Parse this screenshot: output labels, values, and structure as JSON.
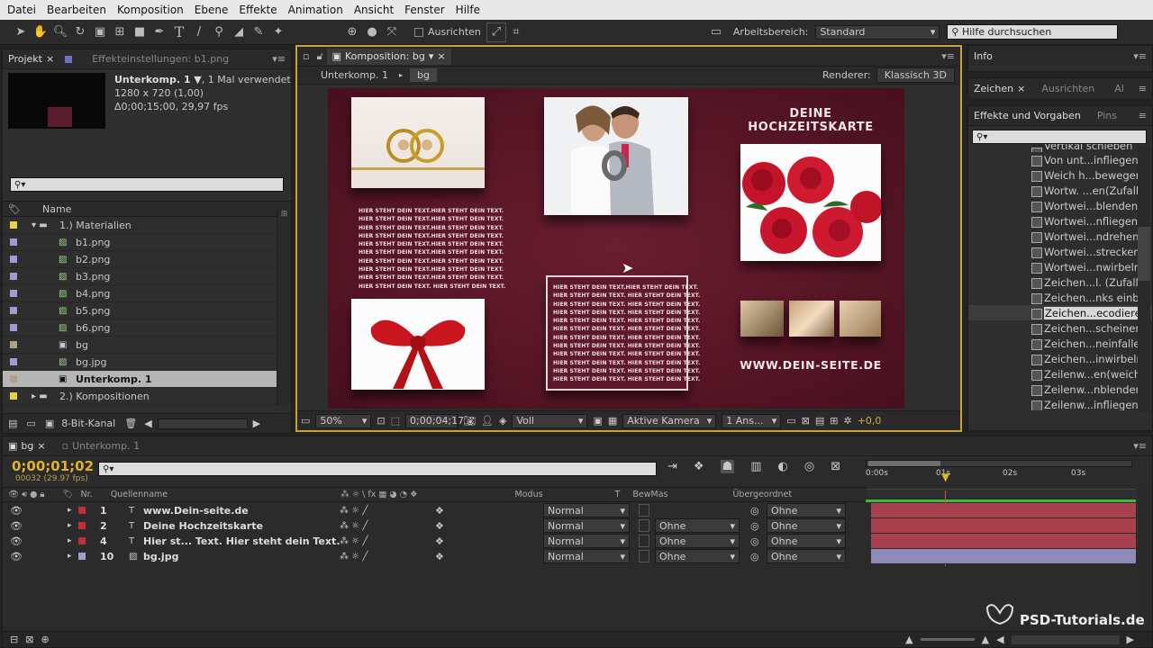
{
  "menu": [
    "Datei",
    "Bearbeiten",
    "Komposition",
    "Ebene",
    "Effekte",
    "Animation",
    "Ansicht",
    "Fenster",
    "Hilfe"
  ],
  "toolbar": {
    "align_label": "Ausrichten",
    "workspace_label": "Arbeitsbereich:",
    "workspace_value": "Standard",
    "help_placeholder": "Hilfe durchsuchen"
  },
  "project": {
    "tab_project": "Projekt",
    "tab_effects": "Effekteinstellungen: b1.png",
    "comp_name": "Unterkomp. 1 ▼",
    "comp_usage": ", 1 Mal verwendet",
    "comp_size": "1280 x 720 (1,00)",
    "comp_duration": "Δ0;00;15;00, 29,97 fps",
    "search_icon": "⚲▾",
    "col_name": "Name",
    "items": [
      {
        "label": "1.) Materialien",
        "type": "folder",
        "indent": 0,
        "color": "#e4d34a",
        "open": true
      },
      {
        "label": "b1.png",
        "type": "image",
        "indent": 1,
        "color": "#9d9dd0"
      },
      {
        "label": "b2.png",
        "type": "image",
        "indent": 1,
        "color": "#9d9dd0"
      },
      {
        "label": "b3.png",
        "type": "image",
        "indent": 1,
        "color": "#9d9dd0"
      },
      {
        "label": "b4.png",
        "type": "image",
        "indent": 1,
        "color": "#9d9dd0"
      },
      {
        "label": "b5.png",
        "type": "image",
        "indent": 1,
        "color": "#9d9dd0"
      },
      {
        "label": "b6.png",
        "type": "image",
        "indent": 1,
        "color": "#9d9dd0"
      },
      {
        "label": "bg",
        "type": "comp",
        "indent": 1,
        "color": "#b0a088"
      },
      {
        "label": "bg.jpg",
        "type": "image",
        "indent": 1,
        "color": "#9d9dd0"
      },
      {
        "label": "Unterkomp. 1",
        "type": "comp",
        "indent": 1,
        "color": "#b0a088",
        "selected": true
      },
      {
        "label": "2.) Kompositionen",
        "type": "folder",
        "indent": 0,
        "color": "#e4d34a",
        "open": false
      }
    ],
    "bit_depth": "8-Bit-Kanal"
  },
  "composition": {
    "tab_label": "Komposition: bg",
    "breadcrumb_1": "Unterkomp. 1",
    "breadcrumb_2": "bg",
    "renderer_label": "Renderer:",
    "renderer_value": "Klassisch 3D",
    "title": "DEINE HOCHZEITSKARTE",
    "website": "WWW.DEIN-SEITE.DE",
    "body_text_line": "HIER STEHT DEIN TEXT.HIER STEHT DEIN TEXT.",
    "body_text_line_b": "HIER STEHT DEIN TEXT. HIER STEHT DEIN TEXT.",
    "zoom": "50%",
    "timecode": "0;00;04;17",
    "resolution": "Voll",
    "camera": "Aktive Kamera",
    "views": "1 Ans...",
    "exposure": "+0,0"
  },
  "info": {
    "tab_info": "Info",
    "tab_zeichen": "Zeichen",
    "tab_ausrichten": "Ausrichten",
    "tab_al": "Al",
    "tab_effects": "Effekte und Vorgaben",
    "tab_pins": "Pins",
    "effects": [
      "Vertikal schieben",
      "Von unt...infliegen",
      "Weich h...bewegen",
      "Wortw. ...en(Zufall)",
      "Wortwei...blenden",
      "Wortwei...nfliegen",
      "Wortwei...ndrehen",
      "Wortwei...strecken",
      "Wortwei...nwirbeln",
      "Zeichen...l. (Zufall)",
      "Zeichen...nks einbl",
      "Zeichen...ecodieren",
      "Zeichen...scheinen",
      "Zeichen...neinfallen",
      "Zeichen...inwirbeln",
      "Zeilenw...en(weich)",
      "Zeilenw...nblenden",
      "Zeilenw...infliegen"
    ],
    "selected_effect": "Zeichen...ecodieren"
  },
  "timeline": {
    "tab_bg": "bg",
    "tab_sub": "Unterkomp. 1",
    "timecode": "0;00;01;02",
    "frames": "00032 (29.97 fps)",
    "col_nr": "Nr.",
    "col_source": "Quellenname",
    "col_mode": "Modus",
    "col_t": "T",
    "col_trkmat": "BewMas",
    "col_parent": "Übergeordnet",
    "ruler": [
      "0:00s",
      "01s",
      "02s",
      "03s"
    ],
    "layers": [
      {
        "nr": "1",
        "name": "www.Dein-seite.de",
        "type": "T",
        "color": "#c0303a",
        "mode": "Normal",
        "trkmat": "",
        "parent": "Ohne",
        "bar": "#a8404e"
      },
      {
        "nr": "2",
        "name": "Deine Hochzeitskarte",
        "type": "T",
        "color": "#c0303a",
        "mode": "Normal",
        "trkmat": "Ohne",
        "parent": "Ohne",
        "bar": "#a8404e"
      },
      {
        "nr": "4",
        "name": "Hier st... Text. Hier steht dein Text.",
        "type": "T",
        "color": "#c0303a",
        "mode": "Normal",
        "trkmat": "Ohne",
        "parent": "Ohne",
        "bar": "#a8404e"
      },
      {
        "nr": "10",
        "name": "bg.jpg",
        "type": "img",
        "color": "#9d9dd0",
        "mode": "Normal",
        "trkmat": "Ohne",
        "parent": "Ohne",
        "bar": "#8d89b8"
      }
    ]
  },
  "watermark": "PSD-Tutorials.de"
}
